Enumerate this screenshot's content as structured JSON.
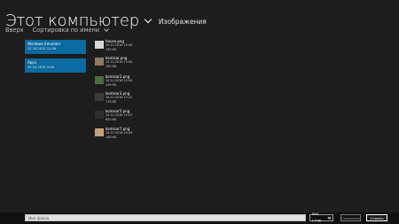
{
  "header": {
    "title": "Этот компьютер",
    "subtitle": "Изображения"
  },
  "toolbar": {
    "up_label": "Вверх",
    "sort_label": "Сортировка по имени"
  },
  "locations": [
    {
      "name": "Windows Emulator",
      "date": "22.10.2015 12:06"
    },
    {
      "name": "Apps",
      "date": "29.12.2015 9:08"
    }
  ],
  "files": [
    {
      "name": "house.png",
      "date": "29.12.2016 15:40",
      "size": "195 КБ"
    },
    {
      "name": "komisar.png",
      "date": "24.12.2016 15:05",
      "size": "192 КБ"
    },
    {
      "name": "komisar2.png",
      "date": "24.12.2016 15:04",
      "size": "149 КБ"
    },
    {
      "name": "komisar3.png",
      "date": "24.12.2016 17:21",
      "size": "718 КБ"
    },
    {
      "name": "komisar5.png",
      "date": "24.12.2016 15:07",
      "size": "620 КБ"
    },
    {
      "name": "komisar7.png",
      "date": "24.12.2016 15:03",
      "size": "148 КБ"
    }
  ],
  "bottom_bar": {
    "filename_placeholder": "Имя файла",
    "file_type": "PNG (.png)",
    "save_label": "Сохранить",
    "cancel_label": "Отмена"
  }
}
